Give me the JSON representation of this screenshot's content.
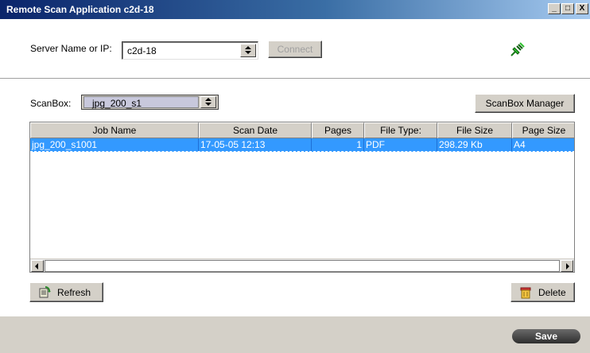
{
  "window": {
    "title": "Remote Scan Application c2d-18",
    "controls": [
      "_",
      "□",
      "X"
    ]
  },
  "server": {
    "label": "Server Name or IP:",
    "value": "c2d-18",
    "connect_label": "Connect",
    "status_icon": "plug-connected-icon"
  },
  "scanbox": {
    "label": "ScanBox:",
    "value": "jpg_200_s1",
    "manager_label": "ScanBox Manager"
  },
  "table": {
    "columns": [
      "Job Name",
      "Scan Date",
      "Pages",
      "File Type:",
      "File Size",
      "Page Size"
    ],
    "rows": [
      {
        "job_name": "jpg_200_s1001",
        "scan_date": "17-05-05 12:13",
        "pages": "1",
        "file_type": "PDF",
        "file_size": "298.29 Kb",
        "page_size": "A4"
      }
    ],
    "selected_color": "#3399ff"
  },
  "actions": {
    "refresh_label": "Refresh",
    "delete_label": "Delete",
    "save_label": "Save"
  }
}
